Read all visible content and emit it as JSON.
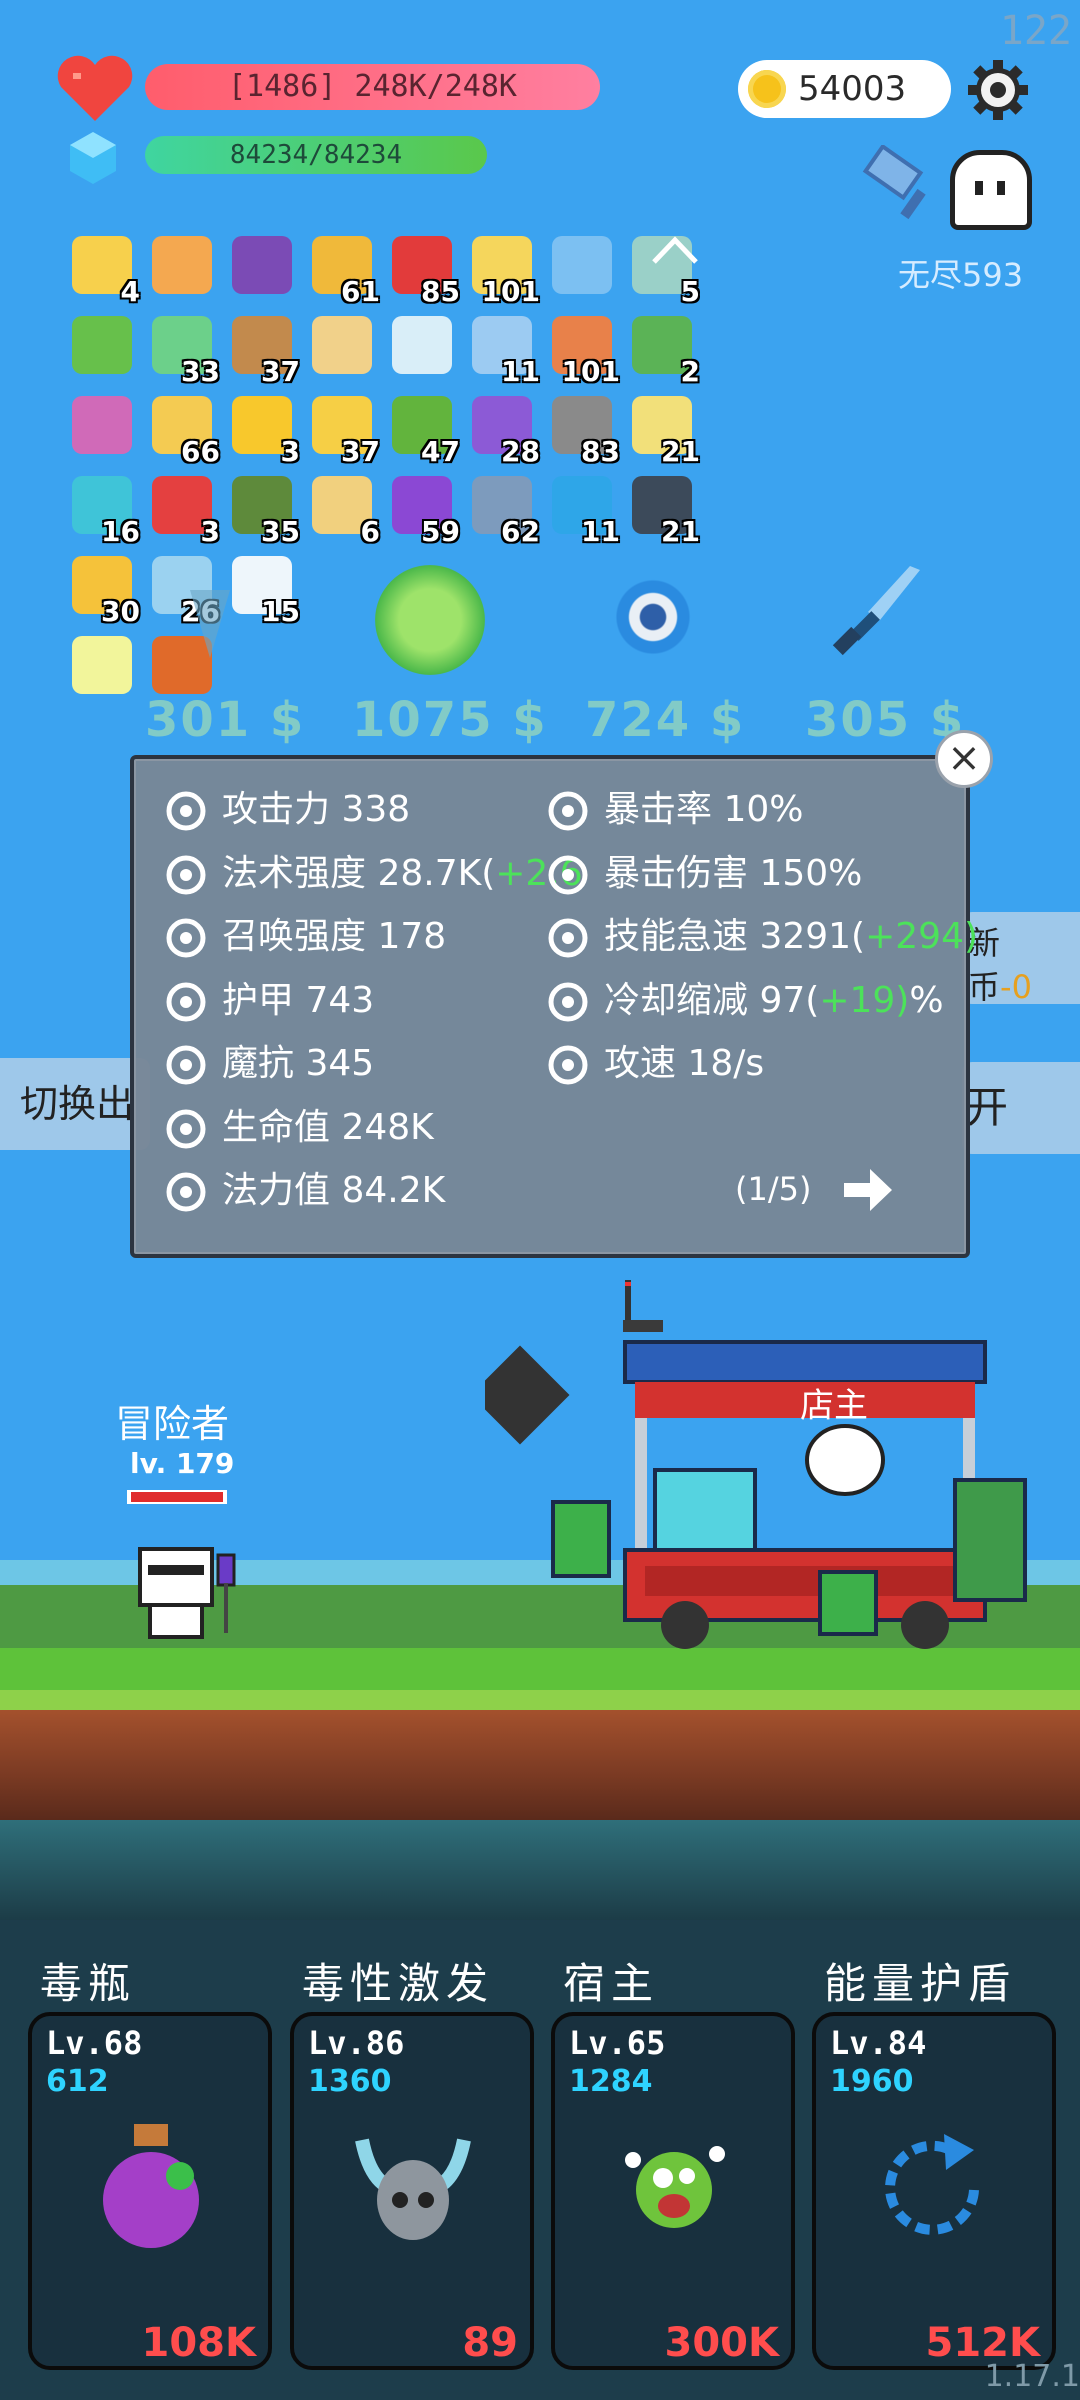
{
  "fps": "122",
  "hp": {
    "text": "[1486] 248K/248K"
  },
  "mp": {
    "text": "84234/84234"
  },
  "coins": "54003",
  "endless": "无尽593",
  "items": [
    {
      "icon": "star-card-icon",
      "count": "4",
      "color": "#f7d04c"
    },
    {
      "icon": "scroll-icon",
      "count": "",
      "color": "#f4a850"
    },
    {
      "icon": "wizard-hat-icon",
      "count": "",
      "color": "#7b4bb5"
    },
    {
      "icon": "pineapple-icon",
      "count": "61",
      "color": "#f0b93a"
    },
    {
      "icon": "mushroom-icon",
      "count": "85",
      "color": "#e23b3b"
    },
    {
      "icon": "bees-icon",
      "count": "101",
      "color": "#f5d65c"
    },
    {
      "icon": "empty-slot-icon",
      "count": "",
      "color": "#7cc0f2"
    },
    {
      "icon": "disk-icon",
      "count": "5",
      "color": "#9ad0c8"
    },
    {
      "icon": "green-card-icon",
      "count": "",
      "color": "#67c04b"
    },
    {
      "icon": "slime-icon",
      "count": "33",
      "color": "#6cd08a"
    },
    {
      "icon": "bow-icon",
      "count": "37",
      "color": "#c28a4d"
    },
    {
      "icon": "parchment-icon",
      "count": "",
      "color": "#f1d18a"
    },
    {
      "icon": "rod-icon",
      "count": "",
      "color": "#d9eef8"
    },
    {
      "icon": "jacket-icon",
      "count": "11",
      "color": "#9ccbf2"
    },
    {
      "icon": "briefcase-icon",
      "count": "101",
      "color": "#e8814a"
    },
    {
      "icon": "money-heart-icon",
      "count": "2",
      "color": "#5bb356"
    },
    {
      "icon": "crystal-ball-icon",
      "count": "",
      "color": "#d06ab8"
    },
    {
      "icon": "note-icon",
      "count": "66",
      "color": "#f4cb52"
    },
    {
      "icon": "sun-icon",
      "count": "3",
      "color": "#f8c82c"
    },
    {
      "icon": "cheese-icon",
      "count": "37",
      "color": "#f6cf45"
    },
    {
      "icon": "lime-icon",
      "count": "47",
      "color": "#62b43d"
    },
    {
      "icon": "shield-purple-icon",
      "count": "28",
      "color": "#8c5ad6"
    },
    {
      "icon": "hook-icon",
      "count": "83",
      "color": "#8a8a8a"
    },
    {
      "icon": "halo-icon",
      "count": "21",
      "color": "#f2e07a"
    },
    {
      "icon": "spiral-icon",
      "count": "16",
      "color": "#3fc4d8"
    },
    {
      "icon": "percent-icon",
      "count": "3",
      "color": "#e44040"
    },
    {
      "icon": "grenade-icon",
      "count": "35",
      "color": "#5e8a3b"
    },
    {
      "icon": "map-icon",
      "count": "6",
      "color": "#f1d07e"
    },
    {
      "icon": "chest-icon",
      "count": "59",
      "color": "#8b48d4"
    },
    {
      "icon": "shield-steel-icon",
      "count": "62",
      "color": "#7d9bbd"
    },
    {
      "icon": "blue-gem-icon",
      "count": "11",
      "color": "#2ea6e8"
    },
    {
      "icon": "dark-book-icon",
      "count": "21",
      "color": "#3c4a5a"
    },
    {
      "icon": "magic-wand-icon",
      "count": "30",
      "color": "#f5c23a"
    },
    {
      "icon": "cloud-cat-icon",
      "count": "26",
      "color": "#9bd2f0"
    },
    {
      "icon": "checklist-icon",
      "count": "15",
      "color": "#eef6fb"
    },
    {
      "icon": "light-tile-icon",
      "count": "",
      "color": "#f2f59b"
    },
    {
      "icon": "fire-tile-icon",
      "count": "",
      "color": "#e06a2a"
    }
  ],
  "prices": [
    "301 $",
    "1075 $",
    "724 $",
    "305 $"
  ],
  "stats_left": [
    {
      "icon": "axe-icon",
      "text": "攻击力 338"
    },
    {
      "icon": "sun-stat-icon",
      "text": "法术强度 28.7K(",
      "plus": "+2.6"
    },
    {
      "icon": "summon-icon",
      "text": "召唤强度 178"
    },
    {
      "icon": "armor-icon",
      "text": "护甲 743"
    },
    {
      "icon": "magic-resist-icon",
      "text": "魔抗 345"
    },
    {
      "icon": "heart-stat-icon",
      "text": "生命值 248K"
    },
    {
      "icon": "mana-stat-icon",
      "text": "法力值 84.2K"
    }
  ],
  "stats_right": [
    {
      "icon": "crit-rate-icon",
      "text": "暴击率 10%",
      "plus": "",
      "suffix": ""
    },
    {
      "icon": "crit-damage-icon",
      "text": "暴击伤害 150%",
      "plus": "",
      "suffix": ""
    },
    {
      "icon": "lightning-icon",
      "text": "技能急速 3291(",
      "plus": "+294)",
      "suffix": ""
    },
    {
      "icon": "hourglass-icon",
      "text": "冷却缩减 97(",
      "plus": "+19)",
      "suffix": "%"
    },
    {
      "icon": "attack-speed-icon",
      "text": "攻速 18/s",
      "plus": "",
      "suffix": ""
    }
  ],
  "page": "(1/5)",
  "side": {
    "left": "切换出",
    "right": "开",
    "refresh_top": "新",
    "refresh_bottom_prefix": "币",
    "refresh_bottom_value": "-0"
  },
  "scene": {
    "adventurer": "冒险者",
    "adventurer_lv": "lv. 179",
    "shop_sign": "店主"
  },
  "skills": [
    {
      "name": "毒瓶",
      "lv": "Lv.68",
      "cost": "612",
      "value": "108K",
      "art": "poison-bottle-icon"
    },
    {
      "name": "毒性激发",
      "lv": "Lv.86",
      "cost": "1360",
      "value": "89",
      "art": "horned-skull-icon"
    },
    {
      "name": "宿主",
      "lv": "Lv.65",
      "cost": "1284",
      "value": "300K",
      "art": "virus-monster-icon"
    },
    {
      "name": "能量护盾",
      "lv": "Lv.84",
      "cost": "1960",
      "value": "512K",
      "art": "refresh-shield-icon"
    }
  ],
  "version": "1.17.1"
}
